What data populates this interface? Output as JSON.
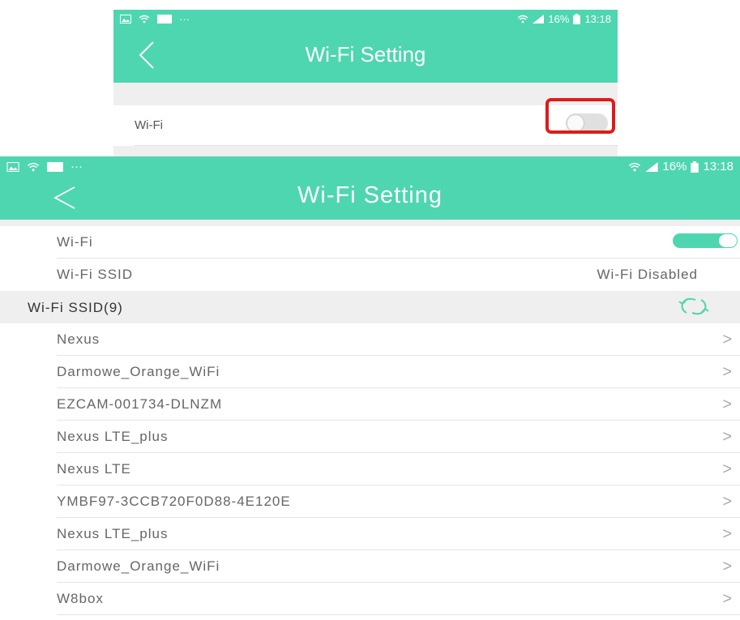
{
  "colors": {
    "accent": "#4ed6b0",
    "highlight": "#e01a1a",
    "background": "#efefef"
  },
  "top_screen": {
    "status": {
      "battery": "16%",
      "time": "13:18",
      "dots": "···"
    },
    "title": "Wi-Fi Setting",
    "wifi_label": "Wi-Fi",
    "wifi_enabled": false
  },
  "bottom_screen": {
    "status": {
      "battery": "16%",
      "time": "13:18",
      "dots": "···"
    },
    "title": "Wi-Fi Setting",
    "wifi_label": "Wi-Fi",
    "wifi_enabled": true,
    "ssid_label": "Wi-Fi SSID",
    "ssid_value": "Wi-Fi Disabled",
    "list_header": "Wi-Fi SSID(9)",
    "chevron": ">",
    "networks": [
      "Nexus",
      "Darmowe_Orange_WiFi",
      "EZCAM-001734-DLNZM",
      "Nexus LTE_plus",
      "Nexus LTE",
      "YMBF97-3CCB720F0D88-4E120E",
      "Nexus LTE_plus",
      "Darmowe_Orange_WiFi",
      "W8box"
    ]
  }
}
